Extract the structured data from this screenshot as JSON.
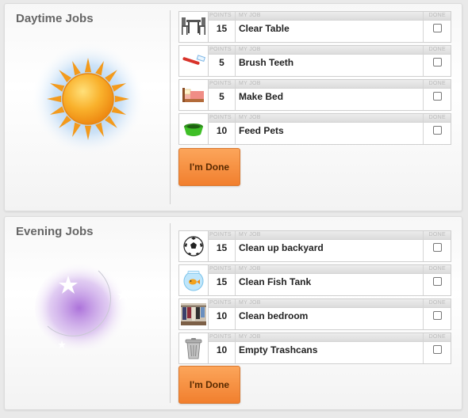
{
  "headers": {
    "points": "POINTS",
    "my_job": "MY JOB",
    "done": "DONE"
  },
  "daytime": {
    "title": "Daytime Jobs",
    "button_label": "I'm Done",
    "jobs": [
      {
        "points": "15",
        "name": "Clear Table",
        "icon": "table-chairs-icon",
        "done": false
      },
      {
        "points": "5",
        "name": "Brush Teeth",
        "icon": "toothbrush-icon",
        "done": false
      },
      {
        "points": "5",
        "name": "Make Bed",
        "icon": "bed-icon",
        "done": false
      },
      {
        "points": "10",
        "name": "Feed Pets",
        "icon": "pet-bowl-icon",
        "done": false
      }
    ]
  },
  "evening": {
    "title": "Evening Jobs",
    "button_label": "I'm Done",
    "jobs": [
      {
        "points": "15",
        "name": "Clean up backyard",
        "icon": "soccer-ball-icon",
        "done": false
      },
      {
        "points": "15",
        "name": "Clean Fish Tank",
        "icon": "fish-bowl-icon",
        "done": false
      },
      {
        "points": "10",
        "name": "Clean bedroom",
        "icon": "closet-icon",
        "done": false
      },
      {
        "points": "10",
        "name": "Empty Trashcans",
        "icon": "trashcan-icon",
        "done": false
      }
    ]
  },
  "colors": {
    "button": "#f5893a",
    "sun": "#f7a21b",
    "sun_glow": "#7ab8f0",
    "moon_glow": "#a86bd8"
  }
}
